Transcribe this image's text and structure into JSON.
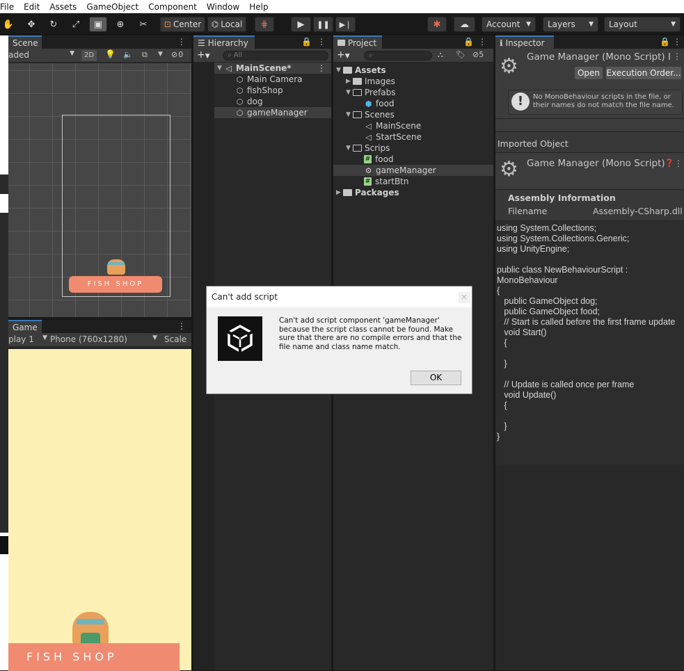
{
  "menu": [
    "File",
    "Edit",
    "Assets",
    "GameObject",
    "Component",
    "Window",
    "Help"
  ],
  "toolbar": {
    "center": "Center",
    "local": "Local",
    "account": "Account",
    "layers": "Layers",
    "layout": "Layout"
  },
  "scene": {
    "tab": "Scene",
    "shading": "aded",
    "mode2d": "2D",
    "hidden_count": "0"
  },
  "game": {
    "tab": "Game",
    "display": "play 1",
    "resolution": "Phone (760x1280)",
    "scale": "Scale",
    "shop_text": "FISH SHOP"
  },
  "hierarchy": {
    "tab": "Hierarchy",
    "search_placeholder": "All",
    "scene": "MainScene*",
    "items": [
      "Main Camera",
      "fishShop",
      "dog",
      "gameManager"
    ]
  },
  "project": {
    "tab": "Project",
    "hidden_count": "5",
    "assets": "Assets",
    "images": "Images",
    "prefabs": "Prefabs",
    "food_prefab": "food",
    "scenes": "Scenes",
    "main_scene": "MainScene",
    "start_scene": "StartScene",
    "scrips": "Scrips",
    "scripts": [
      "food",
      "gameManager",
      "startBtn"
    ],
    "packages": "Packages"
  },
  "inspector": {
    "tab": "Inspector",
    "header_title": "Game Manager (Mono Script) I",
    "open": "Open",
    "execution_order": "Execution Order...",
    "warning": "No MonoBehaviour scripts in the file, or their names do not match the file name.",
    "imported_object": "Imported Object",
    "imported_title": "Game Manager (Mono Script)",
    "assembly_heading": "Assembly Information",
    "filename_label": "Filename",
    "filename_value": "Assembly-CSharp.dll",
    "code": "using System.Collections;\nusing System.Collections.Generic;\nusing UnityEngine;\n\npublic class NewBehaviourScript :\nMonoBehaviour\n{\n   public GameObject dog;\n   public GameObject food;\n   // Start is called before the first frame update\n   void Start()\n   {\n\n   }\n\n   // Update is called once per frame\n   void Update()\n   {\n\n   }\n}"
  },
  "dialog": {
    "title": "Can't add script",
    "message": "Can't add script component 'gameManager' because the script class cannot be found. Make sure that there are no compile errors and that the file name and class name match.",
    "ok": "OK"
  },
  "colors": {
    "accent": "#3a79bb",
    "game_bg": "#fdf0b4",
    "shop_awning": "#f08a70"
  }
}
